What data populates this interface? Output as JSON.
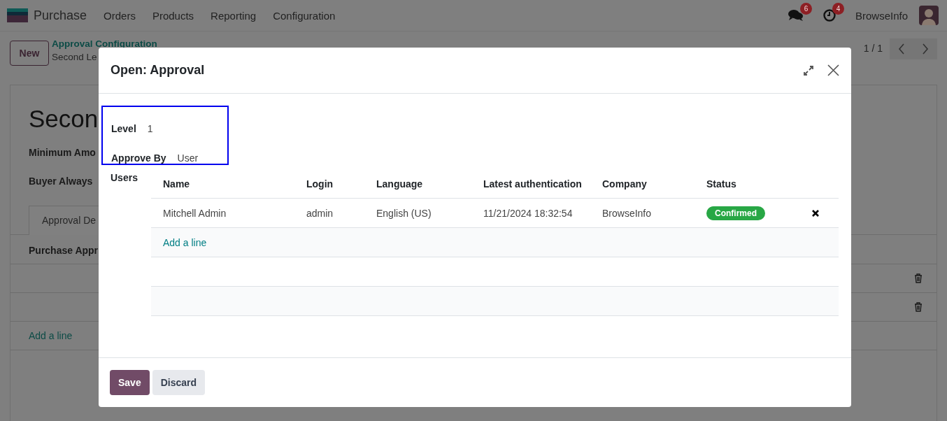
{
  "navbar": {
    "app": "Purchase",
    "menu": [
      "Orders",
      "Products",
      "Reporting",
      "Configuration"
    ],
    "messages_count": "6",
    "activities_count": "4",
    "company": "BrowseInfo"
  },
  "control_panel": {
    "new_button": "New",
    "breadcrumb": "Approval Configuration",
    "record": "Second Le",
    "pager": "1 / 1"
  },
  "form": {
    "title": "Secon",
    "fields": [
      "Minimum Amo",
      "Buyer Always"
    ],
    "tabs": [
      {
        "label": "Approval De",
        "selected": true
      }
    ],
    "section": "Purchase Appr",
    "rows": [
      {
        "kind": "empty"
      },
      {
        "kind": "empty"
      }
    ],
    "add_line": "Add a line"
  },
  "dialog": {
    "title": "Open: Approval",
    "level_label": "Level",
    "level": "1",
    "approve_by_label": "Approve By",
    "approve_by": "User",
    "users_label": "Users",
    "columns": [
      "Name",
      "Login",
      "Language",
      "Latest authentication",
      "Company",
      "Status"
    ],
    "rows": [
      {
        "cells": [
          "Mitchell Admin",
          "admin",
          "English (US)",
          "11/21/2024 18:32:54",
          "BrowseInfo"
        ],
        "status": "Confirmed"
      }
    ],
    "add_line": "Add a line",
    "buttons": [
      {
        "label": "Save",
        "kind": "primary"
      },
      {
        "label": "Discard",
        "kind": "secondary"
      }
    ]
  }
}
